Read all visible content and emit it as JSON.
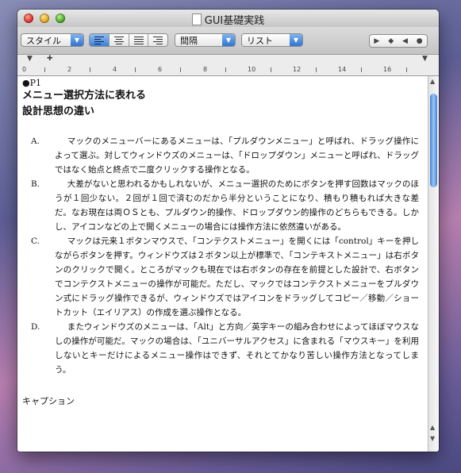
{
  "window": {
    "title": "GUI基礎実践"
  },
  "toolbar": {
    "style_select": "スタイル",
    "spacing_select": "間隔",
    "list_select": "リスト",
    "align_icons": [
      "align-left-icon",
      "align-center-icon",
      "align-justify-icon",
      "align-right-icon"
    ]
  },
  "ruler": {
    "numbers": [
      "0",
      "2",
      "4",
      "6",
      "8",
      "10",
      "12",
      "14",
      "16"
    ]
  },
  "document": {
    "marker": "●P1",
    "heading_line1": "メニュー選択方法に表れる",
    "heading_line2": "設計思想の違い",
    "items": [
      {
        "label": "A.",
        "text": "マックのメニューバーにあるメニューは、「プルダウンメニュー」と呼ばれ、ドラッグ操作によって選ぶ。対してウィンドウズのメニューは、「ドロップダウン」メニューと呼ばれ、ドラッグではなく始点と終点で二度クリックする操作となる。"
      },
      {
        "label": "B.",
        "text": "大差がないと思われるかもしれないが、メニュー選択のためにボタンを押す回数はマックのほうが１回少ない。２回が１回で済むのだから半分ということになり、積もり積もれば大きな差だ。なお現在は両ＯＳとも、プルダウン的操作、ドロップダウン的操作のどちらもできる。しかし、アイコンなどの上で開くメニューの場合には操作方法に依然違いがある。"
      },
      {
        "label": "C.",
        "text": "マックは元来１ボタンマウスで、「コンテクストメニュー」を開くには「control」キーを押しながらボタンを押す。ウィンドウズは２ボタン以上が標準で、「コンテキストメニュー」は右ボタンのクリックで開く。ところがマックも現在では右ボタンの存在を前提とした設計で、右ボタンでコンテクストメニューの操作が可能だ。ただし、マックではコンテクストメニューをプルダウン式にドラッグ操作できるが、ウィンドウズではアイコンをドラッグしてコピー／移動／ショートカット（エイリアス）の作成を選ぶ操作となる。"
      },
      {
        "label": "D.",
        "text": "またウィンドウズのメニューは、「Alt」と方向／英字キーの組み合わせによってほぼマウスなしの操作が可能だ。マックの場合は、「ユニバーサルアクセス」に含まれる「マウスキー」を利用しないとキーだけによるメニュー操作はできず、それとてかなり苦しい操作方法となってしまう。"
      }
    ],
    "caption": "キャプション"
  }
}
